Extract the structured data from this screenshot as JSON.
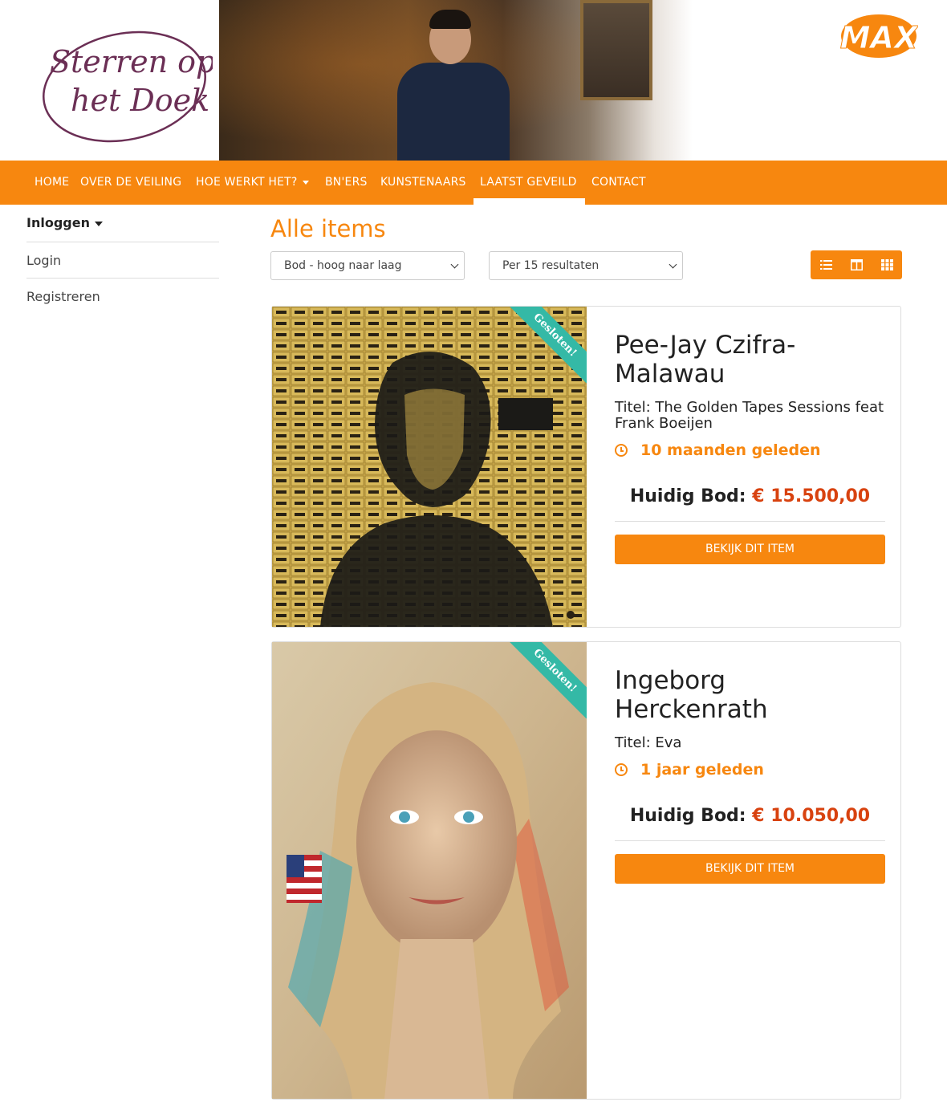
{
  "header": {
    "logo_text_line1": "Sterren op",
    "logo_text_line2": "het Doek",
    "broadcaster_logo": "MAX"
  },
  "nav": {
    "items": [
      {
        "label": "HOME"
      },
      {
        "label": "OVER DE VEILING"
      },
      {
        "label": "HOE WERKT HET?"
      },
      {
        "label": "BN'ERS"
      },
      {
        "label": "KUNSTENAARS"
      },
      {
        "label": "LAATST GEVEILD"
      },
      {
        "label": "CONTACT"
      }
    ],
    "active": "LAATST GEVEILD"
  },
  "sidebar": {
    "heading": "Inloggen",
    "links": [
      {
        "label": "Login"
      },
      {
        "label": "Registreren"
      }
    ]
  },
  "main": {
    "title": "Alle items",
    "sort_select": "Bod - hoog naar laag",
    "per_page_select": "Per 15 resultaten",
    "view_icons": [
      "list-icon",
      "columns-icon",
      "grid-icon"
    ]
  },
  "items": [
    {
      "ribbon": "Gesloten!",
      "artist": "Pee-Jay Czifra-Malawau",
      "titel": "Titel: The Golden Tapes Sessions feat Frank Boeijen",
      "time": "10 maanden geleden",
      "bid_label": "Huidig Bod:",
      "bid_amount": "€ 15.500,00",
      "button": "BEKIJK DIT ITEM"
    },
    {
      "ribbon": "Gesloten!",
      "artist": "Ingeborg Herckenrath",
      "titel": "Titel: Eva",
      "time": "1 jaar geleden",
      "bid_label": "Huidig Bod:",
      "bid_amount": "€ 10.050,00",
      "button": "BEKIJK DIT ITEM"
    }
  ],
  "colors": {
    "accent": "#f7870f",
    "bid": "#d8420f",
    "ribbon": "#34b9a6",
    "logo_purple": "#6b2f55"
  }
}
